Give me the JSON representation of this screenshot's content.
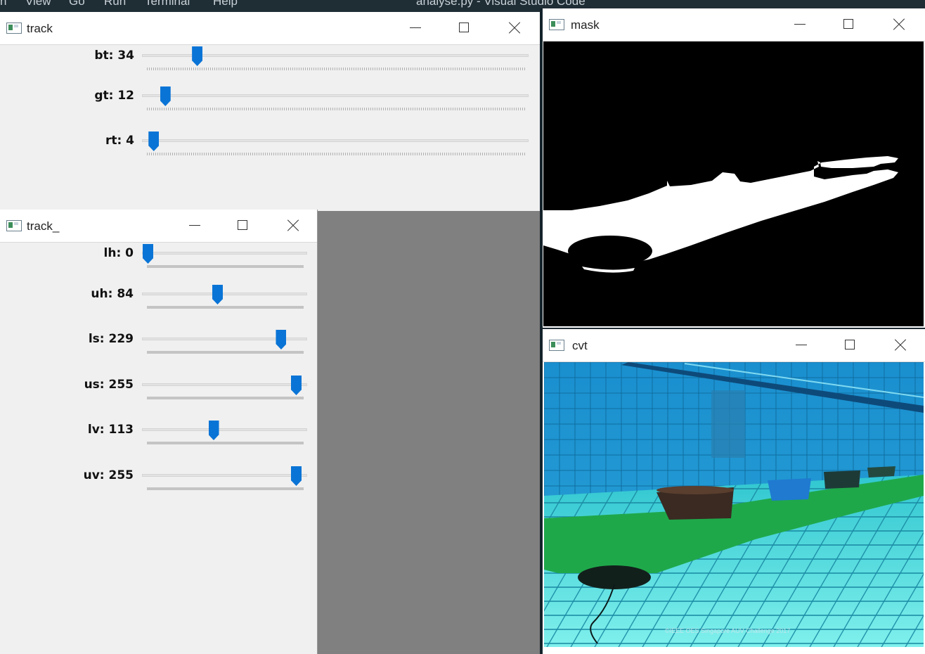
{
  "menubar": {
    "items": [
      "n",
      "View",
      "Go",
      "Run",
      "Terminal",
      "Help"
    ],
    "title": "analyse.py - Visual Studio Code"
  },
  "windows": {
    "track": {
      "title": "track",
      "trackbars": [
        {
          "label": "bt: 34",
          "value": 34,
          "max": 255
        },
        {
          "label": "gt: 12",
          "value": 12,
          "max": 255
        },
        {
          "label": "rt: 4",
          "value": 4,
          "max": 255
        }
      ]
    },
    "track_": {
      "title": "track_",
      "trackbars": [
        {
          "label": "lh: 0",
          "value": 0,
          "max": 179
        },
        {
          "label": "uh: 84",
          "value": 84,
          "max": 179
        },
        {
          "label": "ls: 229",
          "value": 229,
          "max": 255
        },
        {
          "label": "us: 255",
          "value": 255,
          "max": 255
        },
        {
          "label": "lv: 113",
          "value": 113,
          "max": 255
        },
        {
          "label": "uv: 255",
          "value": 255,
          "max": 255
        }
      ]
    },
    "mask": {
      "title": "mask"
    },
    "cvt": {
      "title": "cvt",
      "watermark": "©IEEE OES Singapore AUV Challenge 2017"
    }
  },
  "colors": {
    "thumb": "#0a74d6",
    "window_bg": "#f0f0f0",
    "backdrop": "#808080"
  },
  "icons": {
    "app": "opencv-window-icon",
    "minimize": "minimize-icon",
    "maximize": "maximize-icon",
    "close": "close-icon"
  }
}
